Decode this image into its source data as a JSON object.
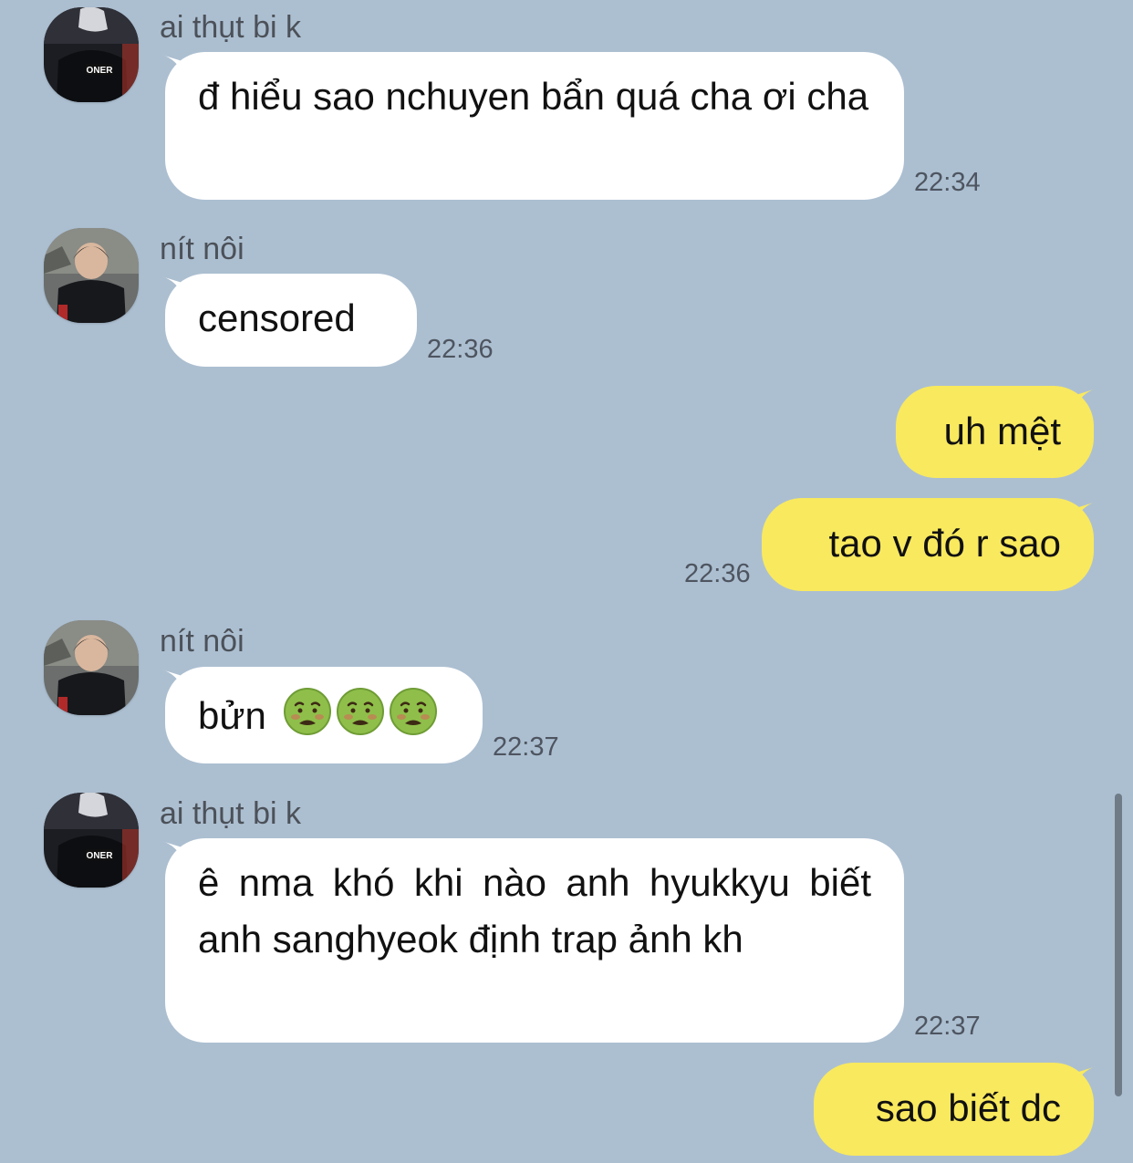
{
  "messages": [
    {
      "sender": "ai thụt bi k",
      "text": "đ hiểu sao nchuyen bẩn quá cha ơi cha",
      "time": "22:34",
      "avatar_icon": "avatar-oner-icon"
    },
    {
      "sender": "nít nôi",
      "text": "censored",
      "time": "22:36",
      "avatar_icon": "avatar-faker-icon"
    },
    {
      "text": "uh mệt"
    },
    {
      "text": "tao v đó r sao",
      "time": "22:36"
    },
    {
      "sender": "nít nôi",
      "text": "bửn",
      "emojis": [
        "nauseated-face-icon",
        "nauseated-face-icon",
        "nauseated-face-icon"
      ],
      "time": "22:37",
      "avatar_icon": "avatar-faker-icon"
    },
    {
      "sender": "ai thụt bi k",
      "text": "ê nma khó khi nào anh hyukkyu biết anh sanghyeok định trap ảnh kh",
      "time": "22:37",
      "avatar_icon": "avatar-oner-icon"
    },
    {
      "text": "sao biết dc"
    }
  ],
  "colors": {
    "background": "#acbfd1",
    "incoming_bubble": "#ffffff",
    "outgoing_bubble": "#f9e95e",
    "time_text": "#4e5560",
    "name_text": "#4c5159"
  }
}
